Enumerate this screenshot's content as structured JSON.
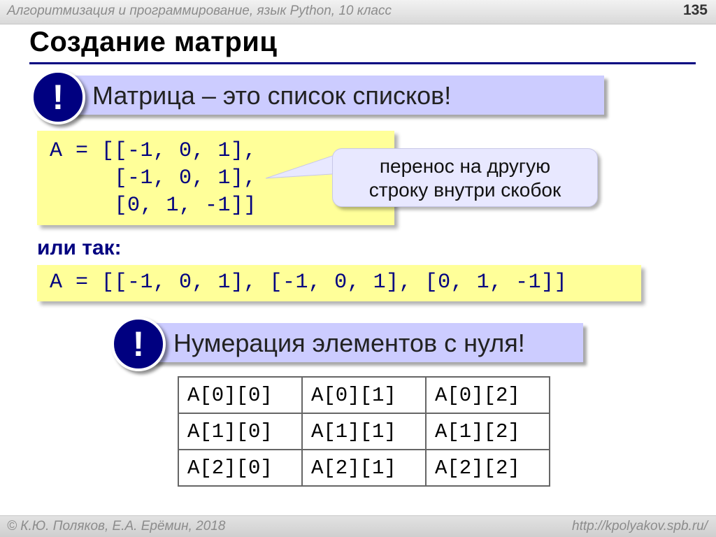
{
  "header": {
    "course": "Алгоритмизация и программирование, язык Python, 10 класс",
    "page_number": "135"
  },
  "slide": {
    "title": "Создание матриц",
    "callout1": {
      "icon": "!",
      "text": "Матрица – это список списков!"
    },
    "code_block1": [
      "A = [[-1, 0, 1],",
      "     [-1, 0, 1],",
      "     [0, 1, -1]]"
    ],
    "bubble": [
      "перенос на другую",
      "строку внутри скобок"
    ],
    "or_label": "или так:",
    "code_block2": "A = [[-1, 0, 1], [-1, 0, 1], [0, 1, -1]]",
    "callout2": {
      "icon": "!",
      "text": "Нумерация элементов с нуля!"
    },
    "index_table": [
      [
        "A[0][0]",
        "A[0][1]",
        "A[0][2]"
      ],
      [
        "A[1][0]",
        "A[1][1]",
        "A[1][2]"
      ],
      [
        "A[2][0]",
        "A[2][1]",
        "A[2][2]"
      ]
    ]
  },
  "footer": {
    "credit": "© К.Ю. Поляков, Е.А. Ерёмин, 2018",
    "url": "http://kpolyakov.spb.ru/"
  },
  "colors": {
    "accent_navy": "#000080",
    "callout_bg": "#ccccff",
    "code_bg": "#ffff99",
    "bubble_bg": "#e8e8ff"
  }
}
